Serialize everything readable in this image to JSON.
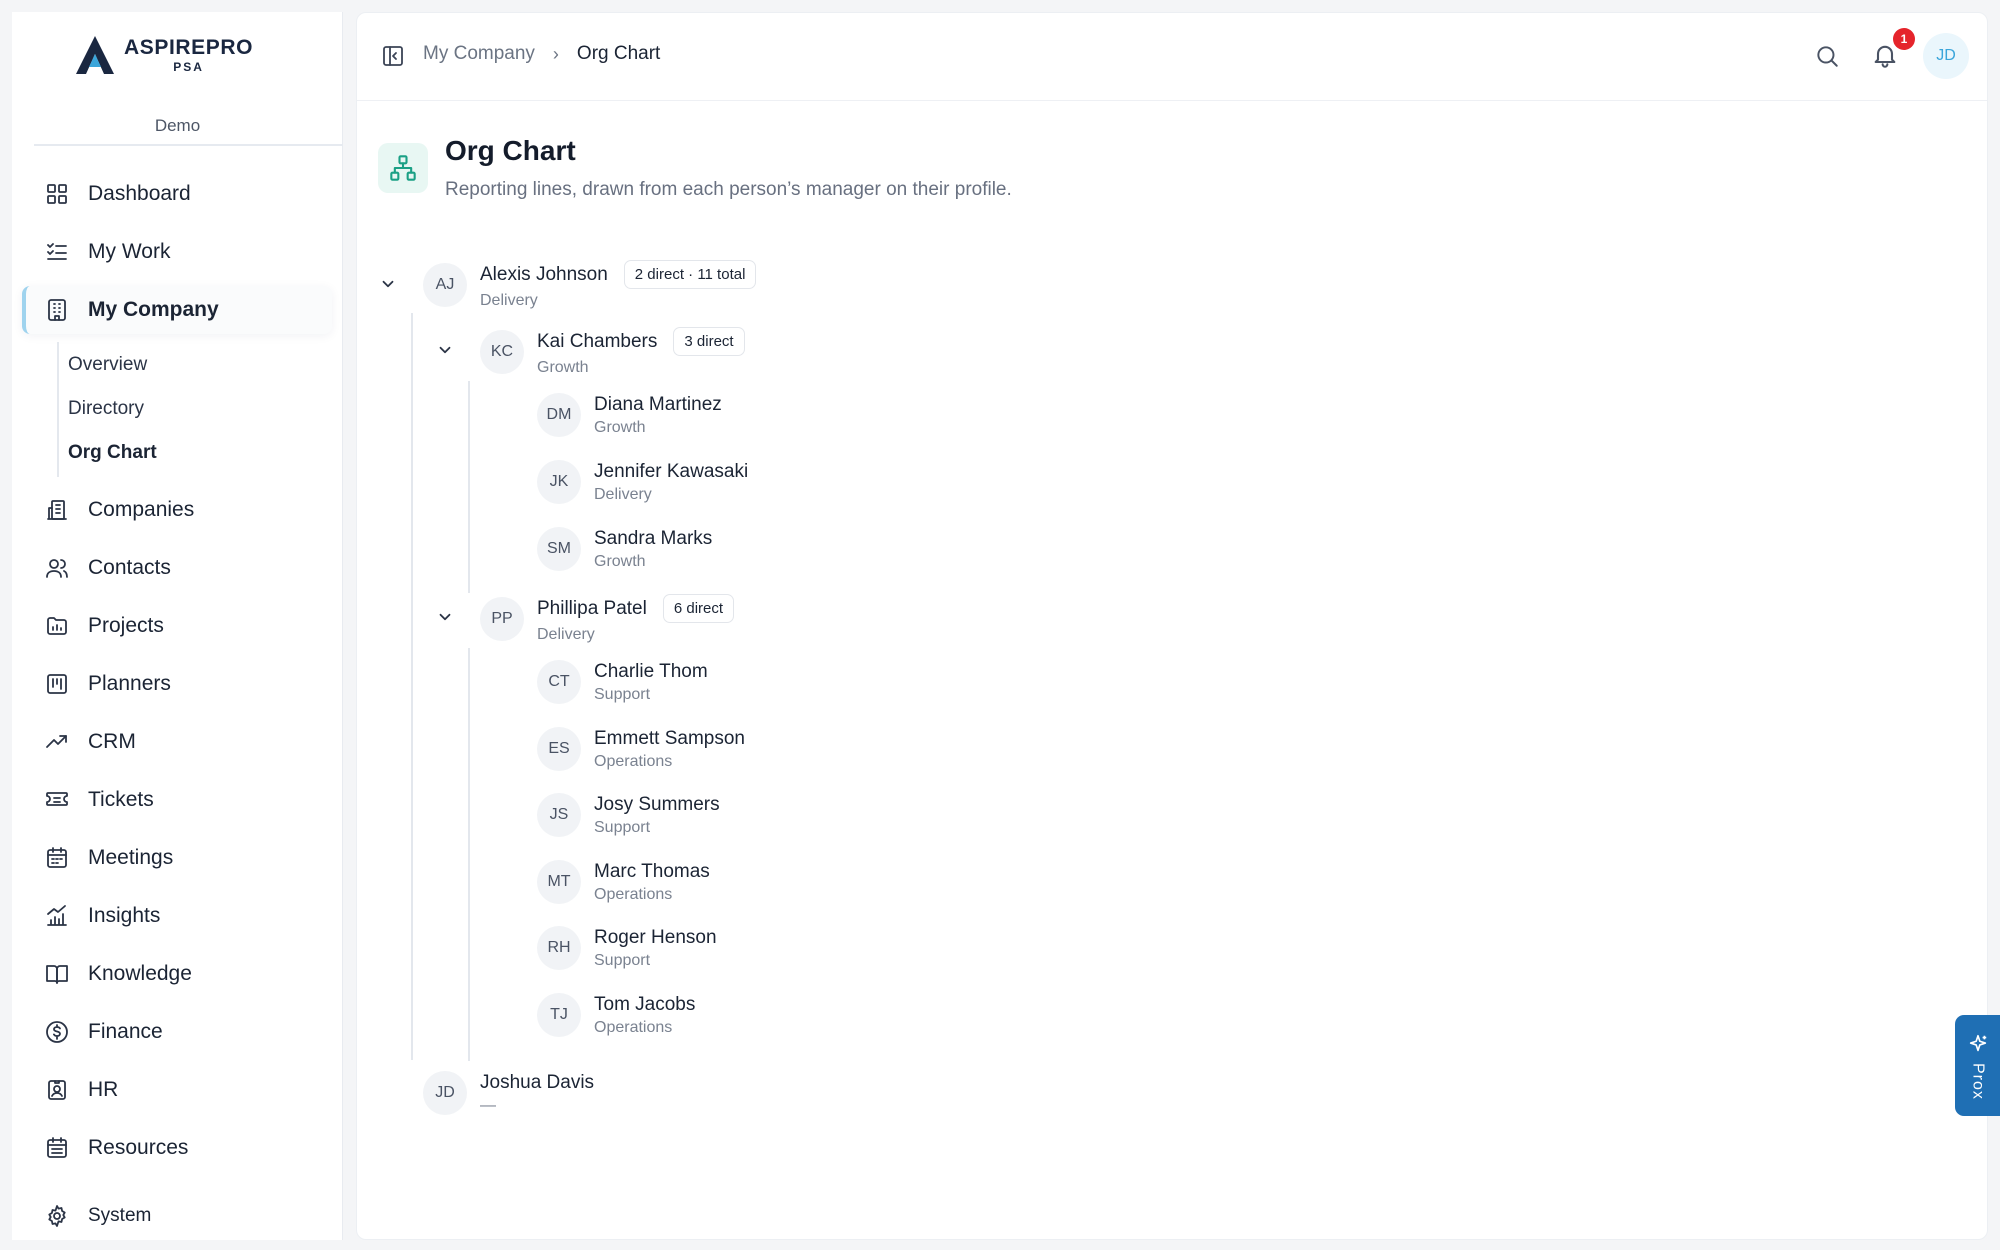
{
  "brand": {
    "name": "ASPIREPRO",
    "sub": "PSA",
    "org": "Demo"
  },
  "nav": {
    "items": [
      {
        "label": "Dashboard",
        "icon": "grid-icon"
      },
      {
        "label": "My Work",
        "icon": "checklist-icon"
      },
      {
        "label": "My Company",
        "icon": "building-icon"
      },
      {
        "label": "Companies",
        "icon": "companies-icon"
      },
      {
        "label": "Contacts",
        "icon": "users-icon"
      },
      {
        "label": "Projects",
        "icon": "folder-chart-icon"
      },
      {
        "label": "Planners",
        "icon": "kanban-icon"
      },
      {
        "label": "CRM",
        "icon": "trending-up-icon"
      },
      {
        "label": "Tickets",
        "icon": "ticket-icon"
      },
      {
        "label": "Meetings",
        "icon": "calendar-icon"
      },
      {
        "label": "Insights",
        "icon": "bar-chart-icon"
      },
      {
        "label": "Knowledge",
        "icon": "book-icon"
      },
      {
        "label": "Finance",
        "icon": "dollar-circle-icon"
      },
      {
        "label": "HR",
        "icon": "badge-icon"
      },
      {
        "label": "Resources",
        "icon": "calendar-grid-icon"
      }
    ],
    "sub_items": [
      "Overview",
      "Directory",
      "Org Chart"
    ],
    "system": "System"
  },
  "breadcrumb": {
    "parent": "My Company",
    "sep": "›",
    "current": "Org Chart"
  },
  "topbar": {
    "notification_count": "1",
    "avatar_initials": "JD"
  },
  "page": {
    "title": "Org Chart",
    "subtitle": "Reporting lines, drawn from each person’s manager on their profile."
  },
  "tree": {
    "root": {
      "initials": "AJ",
      "name": "Alexis Johnson",
      "dept": "Delivery",
      "badge": "2 direct · 11 total"
    },
    "managers": [
      {
        "initials": "KC",
        "name": "Kai Chambers",
        "dept": "Growth",
        "badge": "3 direct",
        "reports": [
          {
            "initials": "DM",
            "name": "Diana Martinez",
            "dept": "Growth"
          },
          {
            "initials": "JK",
            "name": "Jennifer Kawasaki",
            "dept": "Delivery"
          },
          {
            "initials": "SM",
            "name": "Sandra Marks",
            "dept": "Growth"
          }
        ]
      },
      {
        "initials": "PP",
        "name": "Phillipa Patel",
        "dept": "Delivery",
        "badge": "6 direct",
        "reports": [
          {
            "initials": "CT",
            "name": "Charlie Thom",
            "dept": "Support"
          },
          {
            "initials": "ES",
            "name": "Emmett Sampson",
            "dept": "Operations"
          },
          {
            "initials": "JS",
            "name": "Josy Summers",
            "dept": "Support"
          },
          {
            "initials": "MT",
            "name": "Marc Thomas",
            "dept": "Operations"
          },
          {
            "initials": "RH",
            "name": "Roger Henson",
            "dept": "Support"
          },
          {
            "initials": "TJ",
            "name": "Tom Jacobs",
            "dept": "Operations"
          }
        ]
      }
    ],
    "other": {
      "initials": "JD",
      "name": "Joshua Davis",
      "dept": "—"
    }
  },
  "assistant": {
    "label": "Prox"
  },
  "colors": {
    "accent": "#3aa5da",
    "badge": "#e5242b",
    "assistant": "#1f6fb4",
    "page_icon": "#1aa085"
  }
}
